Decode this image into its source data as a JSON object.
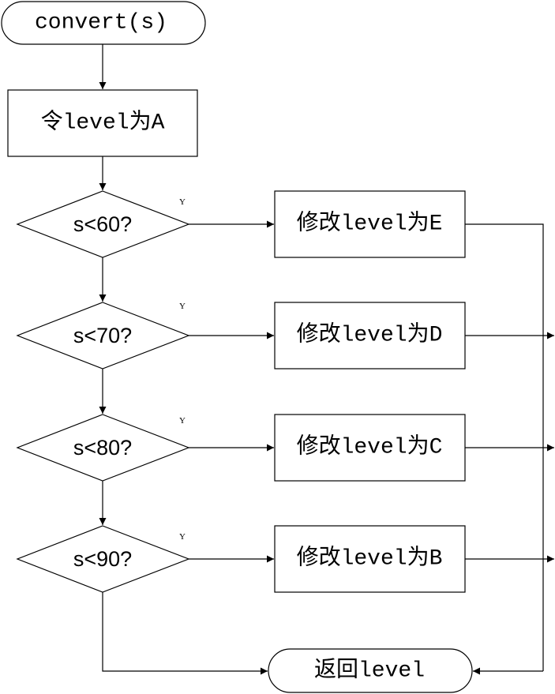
{
  "diagram": {
    "start": "convert(s)",
    "init": "令level为A",
    "yes_label": "Y",
    "conditions": [
      {
        "test": "s<60?",
        "action": "修改level为E"
      },
      {
        "test": "s<70?",
        "action": "修改level为D"
      },
      {
        "test": "s<80?",
        "action": "修改level为C"
      },
      {
        "test": "s<90?",
        "action": "修改level为B"
      }
    ],
    "end": "返回level"
  }
}
